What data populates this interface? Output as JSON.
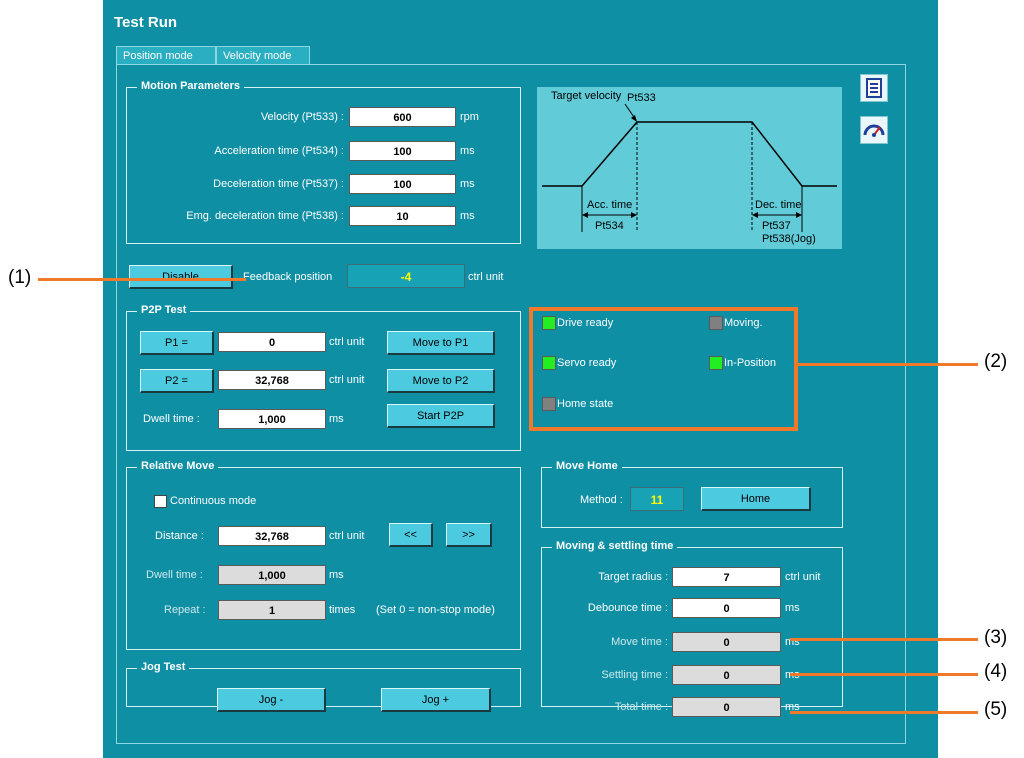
{
  "window": {
    "title": "Test Run"
  },
  "tabs": [
    {
      "label": "Position mode",
      "active": true
    },
    {
      "label": "Velocity mode",
      "active": false
    }
  ],
  "motion": {
    "title": "Motion Parameters",
    "velocity_label": "Velocity (Pt533)",
    "velocity_value": "600",
    "velocity_unit": "rpm",
    "acc_label": "Acceleration time (Pt534)",
    "acc_value": "100",
    "acc_unit": "ms",
    "dec_label": "Deceleration time (Pt537)",
    "dec_value": "100",
    "dec_unit": "ms",
    "emg_label": "Emg. deceleration time (Pt538)",
    "emg_value": "10",
    "emg_unit": "ms"
  },
  "diagram": {
    "target": "Target velocity",
    "pt533": "Pt533",
    "acc": "Acc. time",
    "pt534": "Pt534",
    "dec": "Dec. time",
    "pt537": "Pt537",
    "pt538": "Pt538(Jog)"
  },
  "feedback": {
    "disable_label": "Disable",
    "label": "Feedback position",
    "value": "-4",
    "unit": "ctrl unit"
  },
  "p2p": {
    "title": "P2P Test",
    "p1_label": "P1 =",
    "p1_value": "0",
    "p1_unit": "ctrl unit",
    "move_p1": "Move to P1",
    "p2_label": "P2 =",
    "p2_value": "32,768",
    "p2_unit": "ctrl unit",
    "move_p2": "Move to P2",
    "dwell_label": "Dwell time :",
    "dwell_value": "1,000",
    "dwell_unit": "ms",
    "start": "Start P2P"
  },
  "status": {
    "drive_ready": "Drive ready",
    "moving": "Moving.",
    "servo_ready": "Servo ready",
    "in_position": "In-Position",
    "home_state": "Home state",
    "colors": {
      "on": "#22ee22",
      "off": "#808080"
    }
  },
  "relative": {
    "title": "Relative Move",
    "continuous": "Continuous mode",
    "distance_label": "Distance :",
    "distance_value": "32,768",
    "distance_unit": "ctrl unit",
    "back": "<<",
    "fwd": ">>",
    "dwell_label": "Dwell time :",
    "dwell_value": "1,000",
    "dwell_unit": "ms",
    "repeat_label": "Repeat :",
    "repeat_value": "1",
    "repeat_unit": "times",
    "repeat_note": "(Set 0 = non-stop mode)"
  },
  "home": {
    "title": "Move Home",
    "method_label": "Method :",
    "method_value": "11",
    "home_button": "Home"
  },
  "settling": {
    "title": "Moving & settling time",
    "radius_label": "Target radius :",
    "radius_value": "7",
    "radius_unit": "ctrl unit",
    "debounce_label": "Debounce time :",
    "debounce_value": "0",
    "debounce_unit": "ms",
    "move_label": "Move time :",
    "move_value": "0",
    "move_unit": "ms",
    "settle_label": "Settling time :",
    "settle_value": "0",
    "settle_unit": "ms",
    "total_label": "Total time :",
    "total_value": "0",
    "total_unit": "ms"
  },
  "jog": {
    "title": "Jog Test",
    "minus": "Jog -",
    "plus": "Jog +"
  },
  "callouts": {
    "c1": "(1)",
    "c2": "(2)",
    "c3": "(3)",
    "c4": "(4)",
    "c5": "(5)"
  },
  "accent": {
    "panel": "#0e8fa4",
    "callout": "#f07a2a"
  }
}
